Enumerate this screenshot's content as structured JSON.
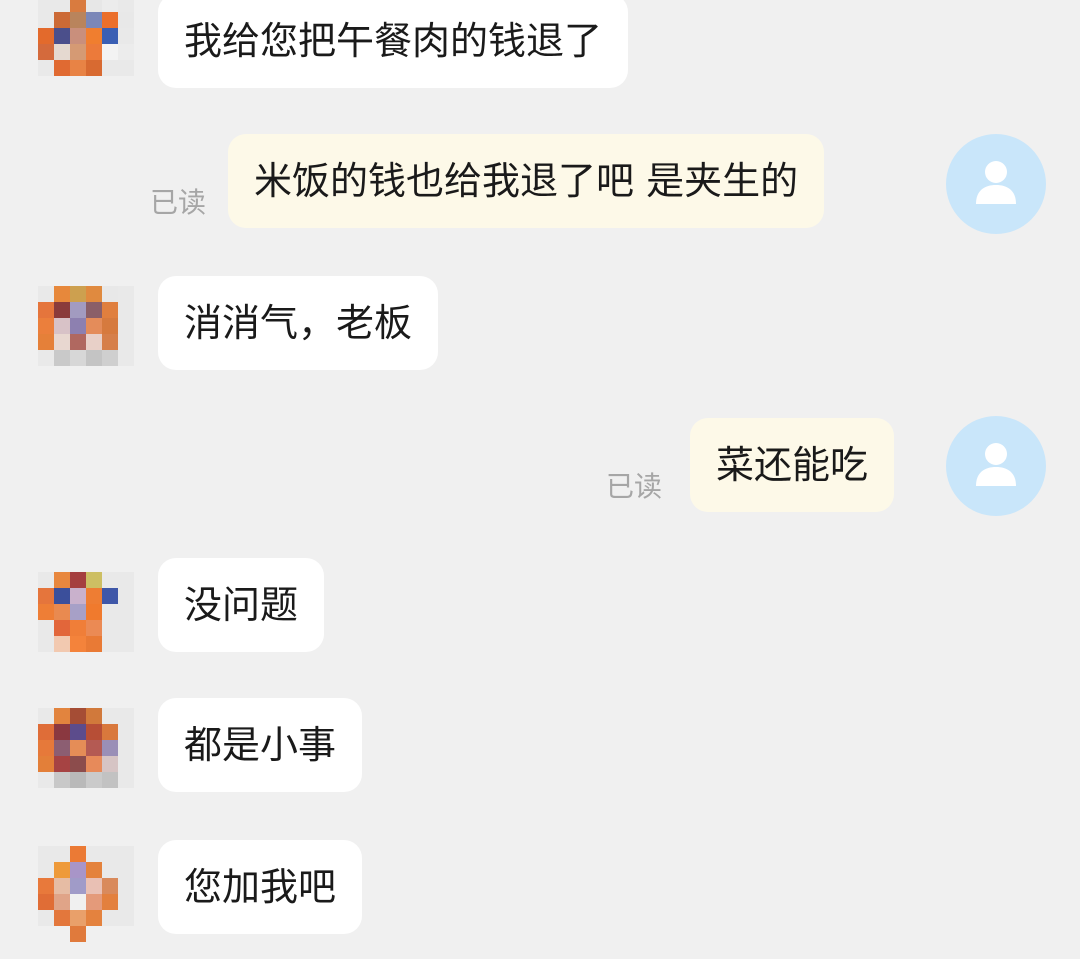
{
  "conversation": {
    "messages": [
      {
        "direction": "incoming",
        "text": "我给您把午餐肉的钱退了"
      },
      {
        "direction": "outgoing",
        "text": "米饭的钱也给我退了吧 是夹生的",
        "status": "已读"
      },
      {
        "direction": "incoming",
        "text": "消消气，老板"
      },
      {
        "direction": "outgoing",
        "text": "菜还能吃",
        "status": "已读"
      },
      {
        "direction": "incoming",
        "text": "没问题"
      },
      {
        "direction": "incoming",
        "text": "都是小事"
      },
      {
        "direction": "incoming",
        "text": "您加我吧"
      }
    ]
  },
  "icons": {
    "self_avatar": "user-silhouette-icon",
    "contact_avatar": "pixelated-avatar"
  },
  "colors": {
    "background": "#f0f0f0",
    "incoming_bubble": "#ffffff",
    "outgoing_bubble": "#fdf9e8",
    "self_avatar_bg": "#c9e6fa",
    "read_status": "#a6a6a6"
  }
}
